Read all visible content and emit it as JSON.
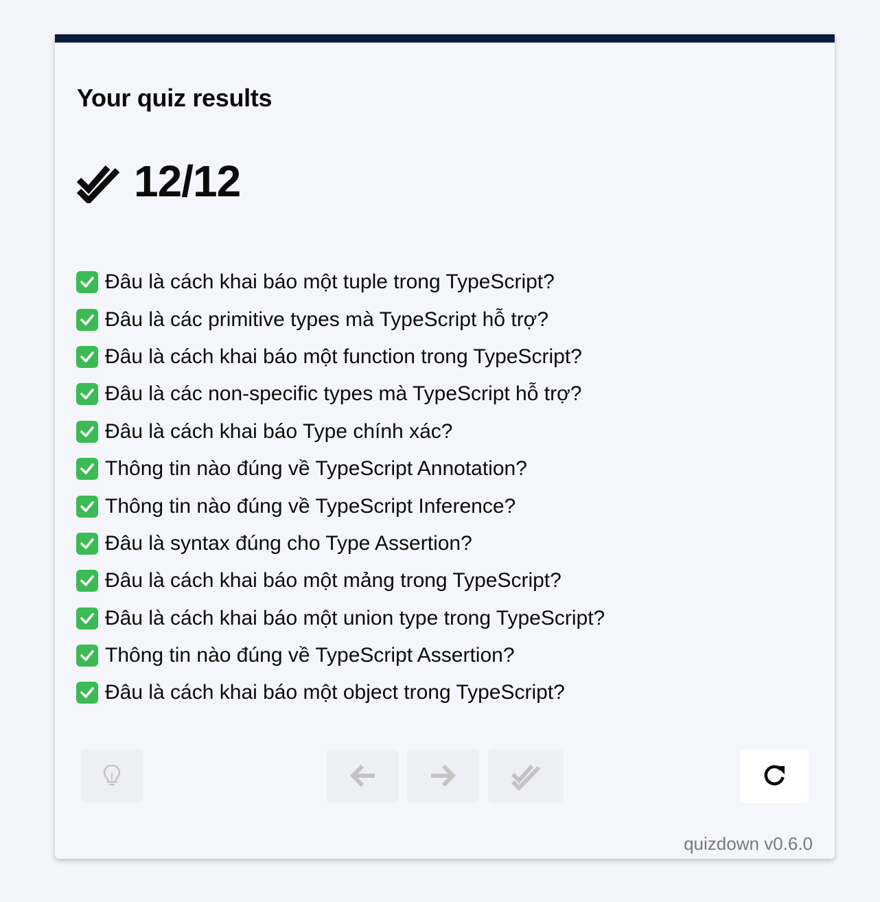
{
  "results": {
    "title": "Your quiz results",
    "score": "12/12"
  },
  "questions": [
    {
      "label": "Đâu là cách khai báo một tuple trong TypeScript?",
      "correct": true
    },
    {
      "label": "Đâu là các primitive types mà TypeScript hỗ trợ?",
      "correct": true
    },
    {
      "label": "Đâu là cách khai báo một function trong TypeScript?",
      "correct": true
    },
    {
      "label": "Đâu là các non-specific types mà TypeScript hỗ trợ?",
      "correct": true
    },
    {
      "label": "Đâu là cách khai báo Type chính xác?",
      "correct": true
    },
    {
      "label": "Thông tin nào đúng về TypeScript Annotation?",
      "correct": true
    },
    {
      "label": "Thông tin nào đúng về TypeScript Inference?",
      "correct": true
    },
    {
      "label": "Đâu là syntax đúng cho Type Assertion?",
      "correct": true
    },
    {
      "label": "Đâu là cách khai báo một mảng trong TypeScript?",
      "correct": true
    },
    {
      "label": "Đâu là cách khai báo một union type trong TypeScript?",
      "correct": true
    },
    {
      "label": "Thông tin nào đúng về TypeScript Assertion?",
      "correct": true
    },
    {
      "label": "Đâu là cách khai báo một object trong TypeScript?",
      "correct": true
    }
  ],
  "toolbar": {
    "hint_icon": "lightbulb-icon",
    "previous_icon": "arrow-left-icon",
    "next_icon": "arrow-right-icon",
    "submit_icon": "double-check-icon",
    "restart_icon": "refresh-icon"
  },
  "footer": {
    "version": "quizdown v0.6.0"
  },
  "colors": {
    "top_bar": "#0b1f3d",
    "correct_badge": "#3cba54",
    "disabled_icon": "#c4c4c4",
    "page_background": "#f4f5fa"
  }
}
